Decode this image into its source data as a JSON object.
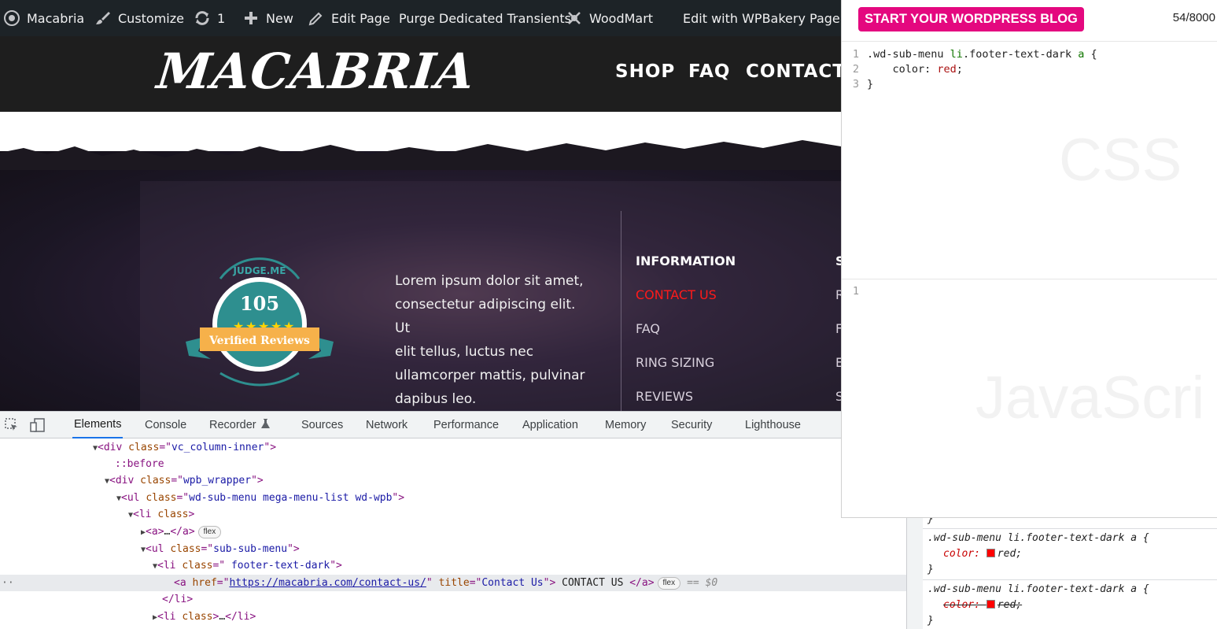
{
  "adminbar": {
    "site_name": "Macabria",
    "customize": "Customize",
    "updates_count": "1",
    "new": "New",
    "edit_page": "Edit Page",
    "purge": "Purge Dedicated Transients",
    "woodmart": "WoodMart",
    "wpbakery": "Edit with WPBakery Page Bu"
  },
  "site": {
    "logo": "MACABRIA",
    "nav": [
      "SHOP",
      "FAQ",
      "CONTACT"
    ]
  },
  "footer": {
    "badge_count": "105",
    "badge_label": "Verified Reviews",
    "badge_arc": "JUDGE.ME",
    "lorem_lines": [
      "Lorem ipsum dolor sit amet,",
      "consectetur adipiscing elit. Ut",
      "elit tellus, luctus nec",
      "ullamcorper mattis, pulvinar",
      "dapibus leo."
    ],
    "info_heading": "INFORMATION",
    "links": [
      "CONTACT US",
      "FAQ",
      "RING SIZING",
      "REVIEWS"
    ],
    "link_colors": {
      "active": "#ff1a1a",
      "normal": "#d8d0dc"
    },
    "cut_letters": [
      "S",
      "R",
      "F",
      "E",
      "S"
    ]
  },
  "devtools": {
    "tabs": [
      "Elements",
      "Console",
      "Recorder",
      "Sources",
      "Network",
      "Performance",
      "Application",
      "Memory",
      "Security",
      "Lighthouse"
    ],
    "active_tab": "Elements",
    "dom": {
      "l1_tag": "div",
      "l1_attr": "class",
      "l1_val": "vc_column-inner",
      "l2": "::before",
      "l3_tag": "div",
      "l3_attr": "class",
      "l3_val": "wpb_wrapper",
      "l4_tag": "ul",
      "l4_attr": "class",
      "l4_val": "wd-sub-menu mega-menu-list wd-wpb",
      "l5_tag": "li",
      "l5_attr": "class",
      "l6_tag": "a",
      "l6_pill": "flex",
      "l7_tag": "ul",
      "l7_attr": "class",
      "l7_val": "sub-sub-menu",
      "l8_tag": "li",
      "l8_attr": "class",
      "l8_val": " footer-text-dark",
      "l9_tag": "a",
      "l9_href_attr": "href",
      "l9_href": "https://macabria.com/contact-us/",
      "l9_title_attr": "title",
      "l9_title": "Contact Us",
      "l9_text": " CONTACT US ",
      "l9_pill": "flex",
      "l9_eq": "== $0",
      "l10_tag": "li",
      "l11_tag": "li",
      "l11_attr": "class"
    },
    "styles": {
      "rule1_selector": ".wd-sub-menu li.footer-text-dark a {",
      "rule1_prop": "color:",
      "rule1_value": "red;",
      "rule2_selector": ".wd-sub-menu li.footer-text-dark a {",
      "rule2_prop": "color:",
      "rule2_value": "red;",
      "close": "}",
      "swatch_color": "#ff0000"
    }
  },
  "cssjs": {
    "blog_button": "START YOUR WORDPRESS BLOG",
    "char_count": "54/8000",
    "css_lines": [
      {
        "n": "1",
        "sel": ".wd-sub-menu ",
        "tag": "li",
        "rest": ".footer-text-dark ",
        "tag2": "a",
        "end": " {"
      },
      {
        "n": "2",
        "prop": "    color: ",
        "val": "red",
        "end": ";"
      },
      {
        "n": "3",
        "end": "}"
      }
    ],
    "css_watermark": "CSS",
    "js_line_number": "1",
    "js_watermark": "JavaScri"
  }
}
